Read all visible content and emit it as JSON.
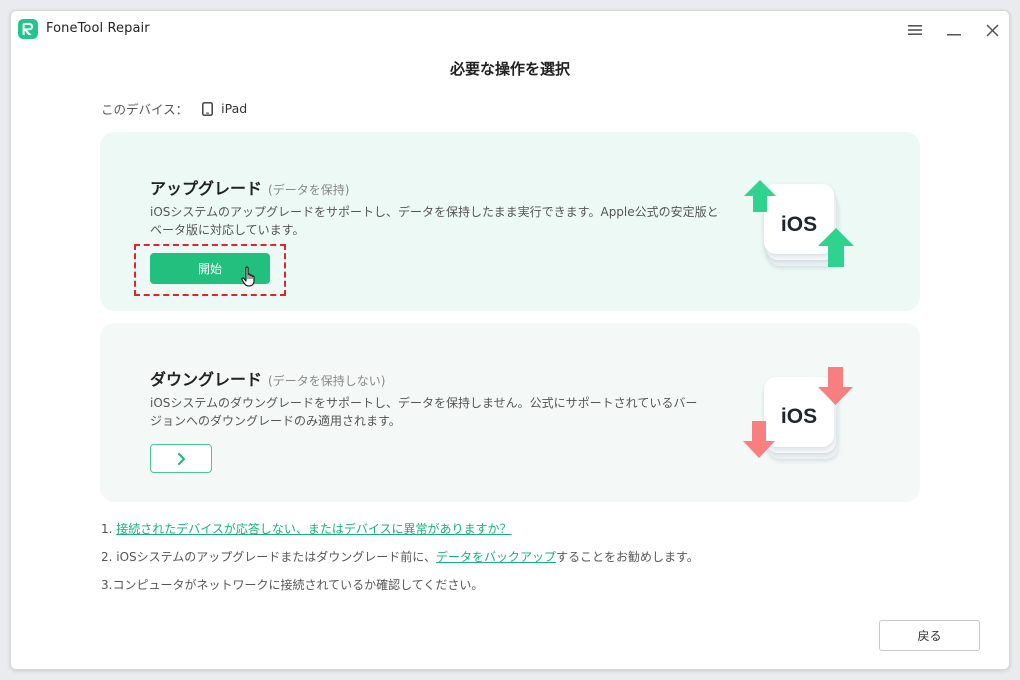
{
  "app": {
    "title": "FoneTool Repair"
  },
  "page": {
    "title": "必要な操作を選択"
  },
  "device": {
    "label": "このデバイス：",
    "name": "iPad"
  },
  "upgrade": {
    "title": "アップグレード",
    "subtitle": "(データを保持)",
    "description_line1": "iOSシステムのアップグレードをサポートし、データを保持したまま実行できます。Apple公式の安定版と",
    "description_line2": "ベータ版に対応しています。",
    "button_label": "開始",
    "badge_text": "iOS"
  },
  "downgrade": {
    "title": "ダウングレード",
    "subtitle": "(データを保持しない)",
    "description_line1": "iOSシステムのダウングレードをサポートし、データを保持しません。公式にサポートされているバー",
    "description_line2": "ジョンへのダウングレードのみ適用されます。",
    "button_icon": "chevron-right-icon",
    "badge_text": "iOS"
  },
  "notes": {
    "n1_prefix": "1. ",
    "n1_link": "接続されたデバイスが応答しない、またはデバイスに異常がありますか？",
    "n2_prefix": "2. iOSシステムのアップグレードまたはダウングレード前に、",
    "n2_link": "データをバックアップ",
    "n2_suffix": "することをお勧めします。",
    "n3": "3.コンピュータがネットワークに接続されているか確認してください。"
  },
  "footer": {
    "back_label": "戻る"
  },
  "colors": {
    "accent": "#22c07e",
    "link": "#1bb07a",
    "upgrade_bg": "#edf9f4",
    "downgrade_bg": "#f4f9f7",
    "arrow_up": "#2fd28f",
    "arrow_down": "#f77f7f",
    "highlight": "#e0232d"
  }
}
